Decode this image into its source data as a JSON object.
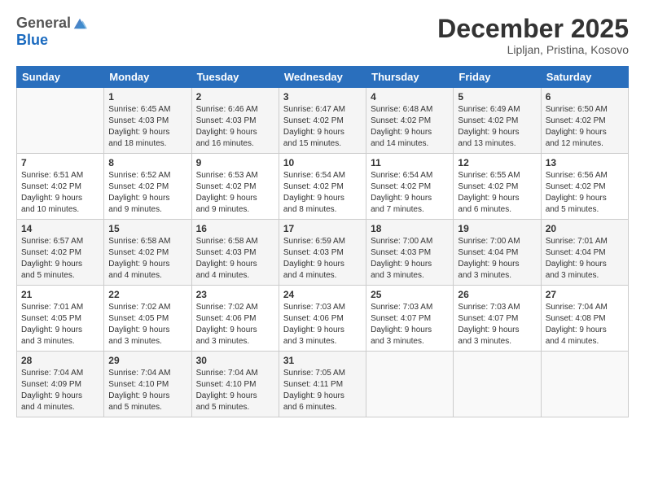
{
  "logo": {
    "general": "General",
    "blue": "Blue"
  },
  "title": {
    "month_year": "December 2025",
    "location": "Lipljan, Pristina, Kosovo"
  },
  "calendar": {
    "days_of_week": [
      "Sunday",
      "Monday",
      "Tuesday",
      "Wednesday",
      "Thursday",
      "Friday",
      "Saturday"
    ],
    "weeks": [
      [
        {
          "day": "",
          "info": ""
        },
        {
          "day": "1",
          "info": "Sunrise: 6:45 AM\nSunset: 4:03 PM\nDaylight: 9 hours\nand 18 minutes."
        },
        {
          "day": "2",
          "info": "Sunrise: 6:46 AM\nSunset: 4:03 PM\nDaylight: 9 hours\nand 16 minutes."
        },
        {
          "day": "3",
          "info": "Sunrise: 6:47 AM\nSunset: 4:02 PM\nDaylight: 9 hours\nand 15 minutes."
        },
        {
          "day": "4",
          "info": "Sunrise: 6:48 AM\nSunset: 4:02 PM\nDaylight: 9 hours\nand 14 minutes."
        },
        {
          "day": "5",
          "info": "Sunrise: 6:49 AM\nSunset: 4:02 PM\nDaylight: 9 hours\nand 13 minutes."
        },
        {
          "day": "6",
          "info": "Sunrise: 6:50 AM\nSunset: 4:02 PM\nDaylight: 9 hours\nand 12 minutes."
        }
      ],
      [
        {
          "day": "7",
          "info": "Sunrise: 6:51 AM\nSunset: 4:02 PM\nDaylight: 9 hours\nand 10 minutes."
        },
        {
          "day": "8",
          "info": "Sunrise: 6:52 AM\nSunset: 4:02 PM\nDaylight: 9 hours\nand 9 minutes."
        },
        {
          "day": "9",
          "info": "Sunrise: 6:53 AM\nSunset: 4:02 PM\nDaylight: 9 hours\nand 9 minutes."
        },
        {
          "day": "10",
          "info": "Sunrise: 6:54 AM\nSunset: 4:02 PM\nDaylight: 9 hours\nand 8 minutes."
        },
        {
          "day": "11",
          "info": "Sunrise: 6:54 AM\nSunset: 4:02 PM\nDaylight: 9 hours\nand 7 minutes."
        },
        {
          "day": "12",
          "info": "Sunrise: 6:55 AM\nSunset: 4:02 PM\nDaylight: 9 hours\nand 6 minutes."
        },
        {
          "day": "13",
          "info": "Sunrise: 6:56 AM\nSunset: 4:02 PM\nDaylight: 9 hours\nand 5 minutes."
        }
      ],
      [
        {
          "day": "14",
          "info": "Sunrise: 6:57 AM\nSunset: 4:02 PM\nDaylight: 9 hours\nand 5 minutes."
        },
        {
          "day": "15",
          "info": "Sunrise: 6:58 AM\nSunset: 4:02 PM\nDaylight: 9 hours\nand 4 minutes."
        },
        {
          "day": "16",
          "info": "Sunrise: 6:58 AM\nSunset: 4:03 PM\nDaylight: 9 hours\nand 4 minutes."
        },
        {
          "day": "17",
          "info": "Sunrise: 6:59 AM\nSunset: 4:03 PM\nDaylight: 9 hours\nand 4 minutes."
        },
        {
          "day": "18",
          "info": "Sunrise: 7:00 AM\nSunset: 4:03 PM\nDaylight: 9 hours\nand 3 minutes."
        },
        {
          "day": "19",
          "info": "Sunrise: 7:00 AM\nSunset: 4:04 PM\nDaylight: 9 hours\nand 3 minutes."
        },
        {
          "day": "20",
          "info": "Sunrise: 7:01 AM\nSunset: 4:04 PM\nDaylight: 9 hours\nand 3 minutes."
        }
      ],
      [
        {
          "day": "21",
          "info": "Sunrise: 7:01 AM\nSunset: 4:05 PM\nDaylight: 9 hours\nand 3 minutes."
        },
        {
          "day": "22",
          "info": "Sunrise: 7:02 AM\nSunset: 4:05 PM\nDaylight: 9 hours\nand 3 minutes."
        },
        {
          "day": "23",
          "info": "Sunrise: 7:02 AM\nSunset: 4:06 PM\nDaylight: 9 hours\nand 3 minutes."
        },
        {
          "day": "24",
          "info": "Sunrise: 7:03 AM\nSunset: 4:06 PM\nDaylight: 9 hours\nand 3 minutes."
        },
        {
          "day": "25",
          "info": "Sunrise: 7:03 AM\nSunset: 4:07 PM\nDaylight: 9 hours\nand 3 minutes."
        },
        {
          "day": "26",
          "info": "Sunrise: 7:03 AM\nSunset: 4:07 PM\nDaylight: 9 hours\nand 3 minutes."
        },
        {
          "day": "27",
          "info": "Sunrise: 7:04 AM\nSunset: 4:08 PM\nDaylight: 9 hours\nand 4 minutes."
        }
      ],
      [
        {
          "day": "28",
          "info": "Sunrise: 7:04 AM\nSunset: 4:09 PM\nDaylight: 9 hours\nand 4 minutes."
        },
        {
          "day": "29",
          "info": "Sunrise: 7:04 AM\nSunset: 4:10 PM\nDaylight: 9 hours\nand 5 minutes."
        },
        {
          "day": "30",
          "info": "Sunrise: 7:04 AM\nSunset: 4:10 PM\nDaylight: 9 hours\nand 5 minutes."
        },
        {
          "day": "31",
          "info": "Sunrise: 7:05 AM\nSunset: 4:11 PM\nDaylight: 9 hours\nand 6 minutes."
        },
        {
          "day": "",
          "info": ""
        },
        {
          "day": "",
          "info": ""
        },
        {
          "day": "",
          "info": ""
        }
      ]
    ]
  }
}
